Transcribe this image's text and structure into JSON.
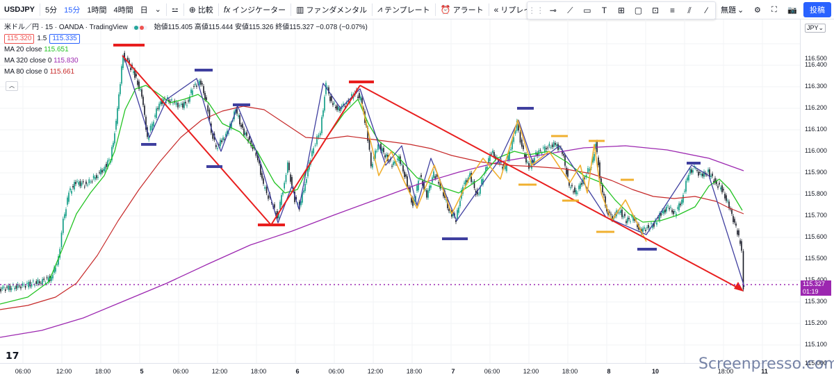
{
  "toolbar": {
    "symbol": "USDJPY",
    "intervals": [
      "5分",
      "15分",
      "1時間",
      "4時間",
      "日"
    ],
    "active_interval": "15分",
    "compare": "比較",
    "indicators": "インジケーター",
    "fundamentals": "ファンダメンタル",
    "templates": "テンプレート",
    "alert": "アラート",
    "replay": "リプレイ",
    "unnamed": "無題",
    "post": "投稿"
  },
  "legend": {
    "title": "米ドル／円 · 15 · OANDA · TradingView",
    "ohlc": "始値115.405 高値115.444 安値115.326 終値115.327 −0.078 (−0.07%)",
    "bid": "115.320",
    "spread": "1.5",
    "ask": "115.335",
    "ma": [
      {
        "label": "MA 20 close",
        "value": "115.651",
        "color": "#22c322"
      },
      {
        "label": "MA 320 close 0",
        "value": "115.830",
        "color": "#9c27b0"
      },
      {
        "label": "MA 80 close 0",
        "value": "115.661",
        "color": "#c62828"
      }
    ]
  },
  "price_axis": {
    "currency": "JPY",
    "labels": [
      "116.500",
      "116.400",
      "116.300",
      "116.200",
      "116.100",
      "116.000",
      "115.900",
      "115.800",
      "115.700",
      "115.600",
      "115.500",
      "115.400",
      "115.300",
      "115.200",
      "115.100",
      "115.000"
    ],
    "current_price": "115.327",
    "countdown": "01:19"
  },
  "time_axis": {
    "labels": [
      "06:00",
      "12:00",
      "18:00",
      "5",
      "06:00",
      "12:00",
      "18:00",
      "6",
      "06:00",
      "12:00",
      "18:00",
      "7",
      "06:00",
      "12:00",
      "18:00",
      "8",
      "10",
      "18:00",
      "11"
    ]
  },
  "watermark": "Screenpresso.com",
  "colors": {
    "ma20": "#22c322",
    "ma80": "#c62828",
    "ma320": "#9c27b0",
    "up": "#089981",
    "down": "#131722",
    "trend": "#e81e1e",
    "zigzag": "#3f3f9f",
    "zigzag_minor": "#f0b030",
    "accent": "#2962ff"
  }
}
